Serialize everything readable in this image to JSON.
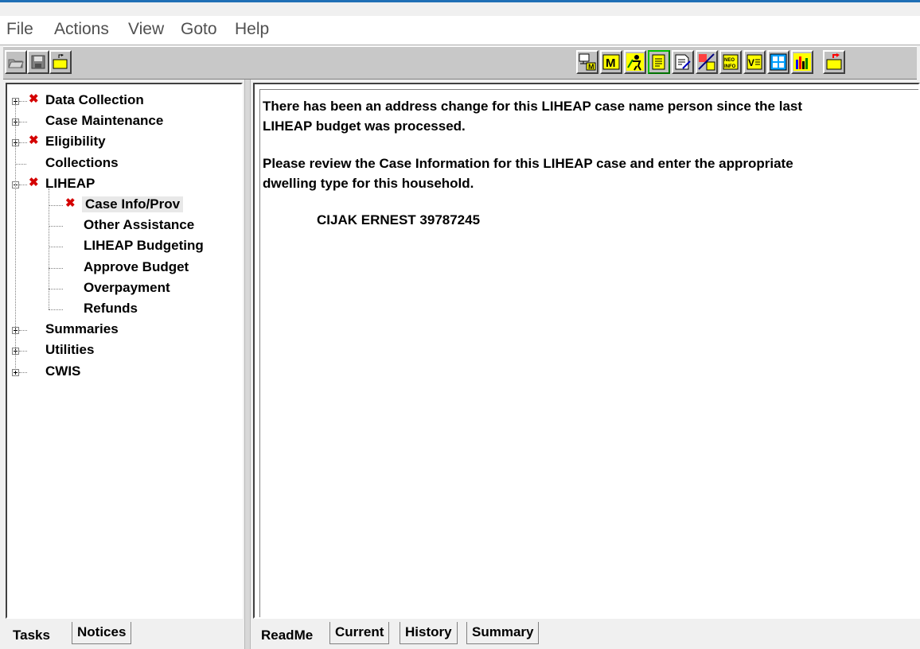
{
  "menu": [
    "File",
    "Actions",
    "View",
    "Goto",
    "Help"
  ],
  "toolbar": {
    "left_buttons": [
      "open-folder-icon",
      "save-disk-icon",
      "new-folder-icon"
    ],
    "right_buttons": [
      "screen-m-icon",
      "m-icon",
      "person-icon",
      "notepad-icon",
      "edit-doc-icon",
      "chart-tool-icon",
      "neo-info-icon",
      "v-list-icon",
      "grid-icon",
      "bar-chart-icon",
      "exit-folder-icon"
    ]
  },
  "tree": {
    "items": [
      {
        "label": "Data Collection",
        "expander": "plus",
        "flag": true
      },
      {
        "label": "Case Maintenance",
        "expander": "plus",
        "flag": false
      },
      {
        "label": "Eligibility",
        "expander": "plus",
        "flag": true
      },
      {
        "label": "Collections",
        "expander": "none",
        "flag": false
      },
      {
        "label": "LIHEAP",
        "expander": "minus",
        "flag": true
      },
      {
        "label": "Case Info/Prov",
        "child": true,
        "flag": true,
        "selected": true
      },
      {
        "label": "Other Assistance",
        "child": true,
        "flag": false
      },
      {
        "label": "LIHEAP Budgeting",
        "child": true,
        "flag": false
      },
      {
        "label": "Approve Budget",
        "child": true,
        "flag": false
      },
      {
        "label": "Overpayment",
        "child": true,
        "flag": false
      },
      {
        "label": "Refunds",
        "child": true,
        "flag": false
      },
      {
        "label": "Summaries",
        "expander": "plus",
        "flag": false
      },
      {
        "label": "Utilities",
        "expander": "plus",
        "flag": false
      },
      {
        "label": "CWIS",
        "expander": "plus",
        "flag": false
      }
    ]
  },
  "message": {
    "line1": "There has been an address change for this LIHEAP case name person since the last",
    "line2": "LIHEAP budget was processed.",
    "line3": "Please review the Case Information for this LIHEAP case and enter the appropriate",
    "line4": "dwelling type for this household.",
    "case_line": "CIJAK ERNEST 39787245"
  },
  "left_tabs": [
    "Tasks",
    "Notices"
  ],
  "right_tabs": [
    "ReadMe",
    "Current",
    "History",
    "Summary"
  ],
  "colors": {
    "flag": "#d40000",
    "title_accent": "#1f6fb5"
  }
}
